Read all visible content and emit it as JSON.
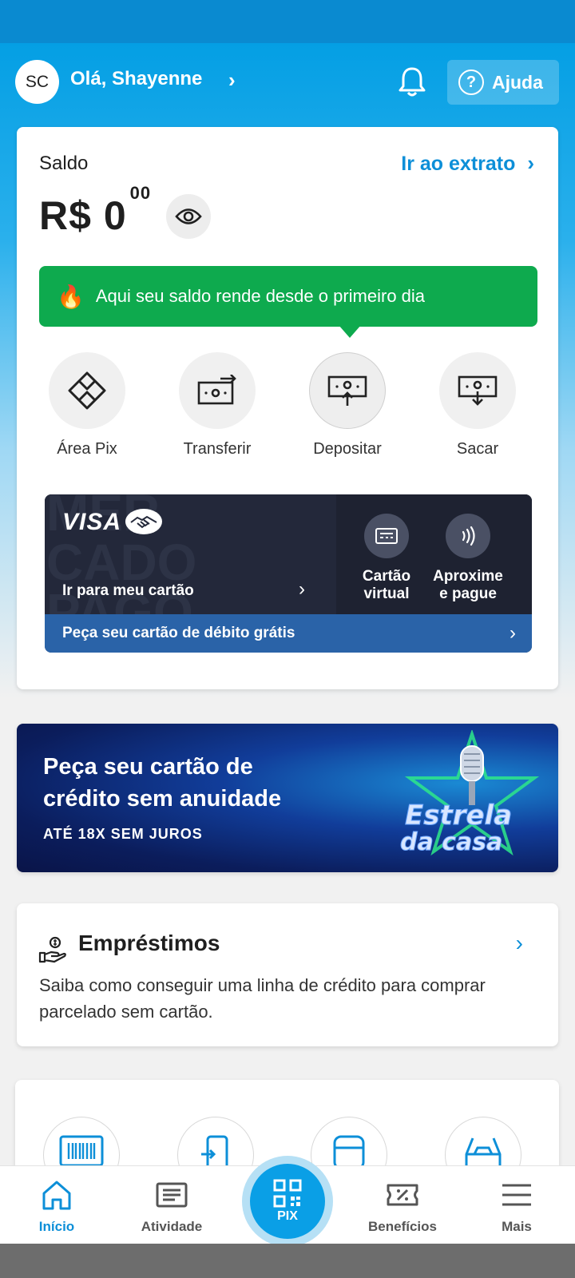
{
  "header": {
    "avatar_initials": "SC",
    "greeting": "Olá, Shayenne",
    "help_label": "Ajuda"
  },
  "balance": {
    "label": "Saldo",
    "statement_link": "Ir ao extrato",
    "currency": "R$",
    "integer": "0",
    "cents": "00"
  },
  "promo": {
    "text": "Aqui seu saldo rende desde o primeiro dia",
    "color": "#0eaa4e"
  },
  "actions": [
    {
      "label": "Área Pix",
      "icon": "pix-diamond-icon"
    },
    {
      "label": "Transferir",
      "icon": "transfer-money-icon"
    },
    {
      "label": "Depositar",
      "icon": "deposit-money-icon"
    },
    {
      "label": "Sacar",
      "icon": "withdraw-money-icon"
    }
  ],
  "card": {
    "brand": "VISA",
    "watermark": "MER\nCADO\nPAGO",
    "go_label": "Ir para meu cartão",
    "virtual_label_1": "Cartão",
    "virtual_label_2": "virtual",
    "contactless_label_1": "Aproxime",
    "contactless_label_2": "e pague",
    "debit_cta": "Peça seu cartão de débito grátis"
  },
  "credit_banner": {
    "title": "Peça seu cartão de crédito sem anuidade",
    "subtitle": "ATÉ 18X SEM JUROS",
    "art_line1": "Estrela",
    "art_line2": "da casa"
  },
  "loans": {
    "title": "Empréstimos",
    "description": "Saiba como conseguir uma linha de crédito para comprar parcelado sem cartão."
  },
  "shortcuts": [
    {
      "icon": "barcode-icon"
    },
    {
      "icon": "phone-recharge-icon"
    },
    {
      "icon": "bus-icon"
    },
    {
      "icon": "car-icon"
    }
  ],
  "tabs": [
    {
      "label": "Início",
      "active": true
    },
    {
      "label": "Atividade",
      "active": false
    },
    {
      "label": "PIX",
      "active": false
    },
    {
      "label": "Benefícios",
      "active": false
    },
    {
      "label": "Mais",
      "active": false
    }
  ],
  "colors": {
    "brand_blue": "#049fe4",
    "link_blue": "#0d8fd8",
    "card_dark": "#23283a",
    "card_cta_blue": "#2a63a8"
  }
}
